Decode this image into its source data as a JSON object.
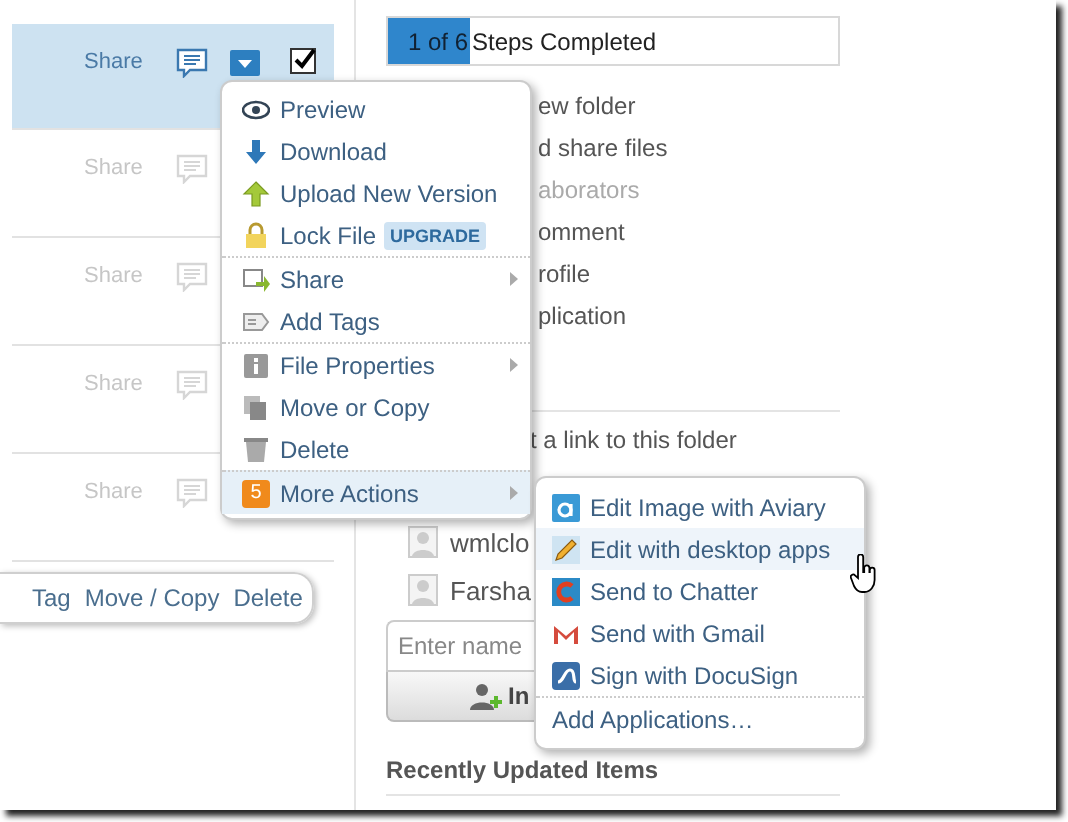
{
  "file_rows": [
    {
      "share": "Share",
      "selected": true,
      "checked": true
    },
    {
      "share": "Share",
      "selected": false
    },
    {
      "share": "Share",
      "selected": false
    },
    {
      "share": "Share",
      "selected": false
    },
    {
      "share": "Share",
      "selected": false
    }
  ],
  "bulk_actions": [
    "Tag",
    "Move / Copy",
    "Delete"
  ],
  "progress": {
    "count": "1 of 6",
    "label": "Steps Completed",
    "level": 0.18
  },
  "steps": [
    {
      "text": "ew folder",
      "done": false
    },
    {
      "text": "d share files",
      "done": false
    },
    {
      "text": "aborators",
      "done": true
    },
    {
      "text": "omment",
      "done": false
    },
    {
      "text": "rofile",
      "done": false
    },
    {
      "text": "plication",
      "done": false
    }
  ],
  "folder_link": "t a link to this folder",
  "collaborators": [
    "wmlclo",
    "Farsha"
  ],
  "invite": {
    "placeholder": "Enter name",
    "button": "In"
  },
  "recent_heading": "Recently Updated Items",
  "context_menu": [
    {
      "label": "Preview",
      "submenu": false,
      "highlighted": false,
      "divider_before": false
    },
    {
      "label": "Download",
      "submenu": false,
      "highlighted": false,
      "divider_before": false
    },
    {
      "label": "Upload New Version",
      "submenu": false,
      "highlighted": false,
      "divider_before": false
    },
    {
      "label": "Lock File",
      "badge": "UPGRADE",
      "submenu": false,
      "highlighted": false,
      "divider_before": false
    },
    {
      "label": "Share",
      "submenu": true,
      "highlighted": false,
      "divider_before": true
    },
    {
      "label": "Add Tags",
      "submenu": false,
      "highlighted": false,
      "divider_before": false
    },
    {
      "label": "File Properties",
      "submenu": true,
      "highlighted": false,
      "divider_before": true
    },
    {
      "label": "Move or Copy",
      "submenu": false,
      "highlighted": false,
      "divider_before": false
    },
    {
      "label": "Delete",
      "submenu": false,
      "highlighted": false,
      "divider_before": false
    },
    {
      "label": "More Actions",
      "icon_text": "5",
      "submenu": true,
      "highlighted": true,
      "divider_before": true
    }
  ],
  "submenu": [
    {
      "label": "Edit Image with Aviary",
      "kind": "app",
      "highlighted": false
    },
    {
      "label": "Edit with desktop apps",
      "kind": "app",
      "highlighted": true
    },
    {
      "label": "Send to Chatter",
      "kind": "app",
      "highlighted": false
    },
    {
      "label": "Send with Gmail",
      "kind": "app",
      "highlighted": false
    },
    {
      "label": "Sign with DocuSign",
      "kind": "app",
      "highlighted": false
    },
    {
      "label": "Add Applications…",
      "kind": "link",
      "highlighted": false
    }
  ]
}
